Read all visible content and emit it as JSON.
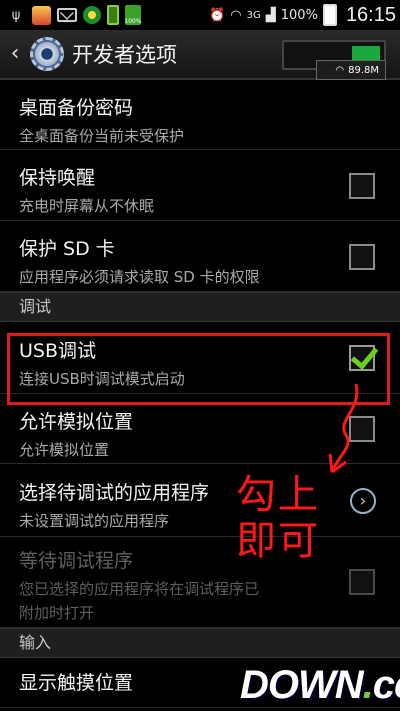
{
  "statusbar": {
    "icons": [
      "usb-icon",
      "app-icon",
      "mail-icon",
      "ball-icon",
      "battery-charging-icon",
      "battery-full-icon",
      "alarm-icon",
      "wifi-icon",
      "signal-icon"
    ],
    "network": "3G",
    "battery": "100%",
    "time": "16:15",
    "percent_small": "100%"
  },
  "actionbar": {
    "title": "开发者选项",
    "speed": "89.8M"
  },
  "items": {
    "backup_password": {
      "title": "桌面备份密码",
      "summary": "全桌面备份当前未受保护"
    },
    "stay_awake": {
      "title": "保持唤醒",
      "summary": "充电时屏幕从不休眠",
      "checked": false
    },
    "protect_sd": {
      "title": "保护 SD 卡",
      "summary": "应用程序必须请求读取 SD 卡的权限",
      "checked": false
    },
    "usb_debug": {
      "title": "USB调试",
      "summary": "连接USB时调试模式启动",
      "checked": true
    },
    "mock_location": {
      "title": "允许模拟位置",
      "summary": "允许模拟位置",
      "checked": false
    },
    "debug_app": {
      "title": "选择待调试的应用程序",
      "summary": "未设置调试的应用程序"
    },
    "wait_debugger": {
      "title": "等待调试程序",
      "summary_line1": "您已选择的应用程序将在调试程序已",
      "summary_line2": "附加时打开",
      "checked": false,
      "disabled": true
    },
    "show_touches": {
      "title": "显示触摸位置"
    }
  },
  "sections": {
    "debug": "调试",
    "input": "输入"
  },
  "annotation": {
    "line1": "勾上",
    "line2": "即可",
    "color": "#ff1818"
  },
  "watermark": {
    "main": "DOWN",
    "dot": ".",
    "suffix": "cc"
  },
  "colors": {
    "highlight": "#e11b1b",
    "check": "#6bcf20",
    "toggle_on": "#1aa93f"
  }
}
